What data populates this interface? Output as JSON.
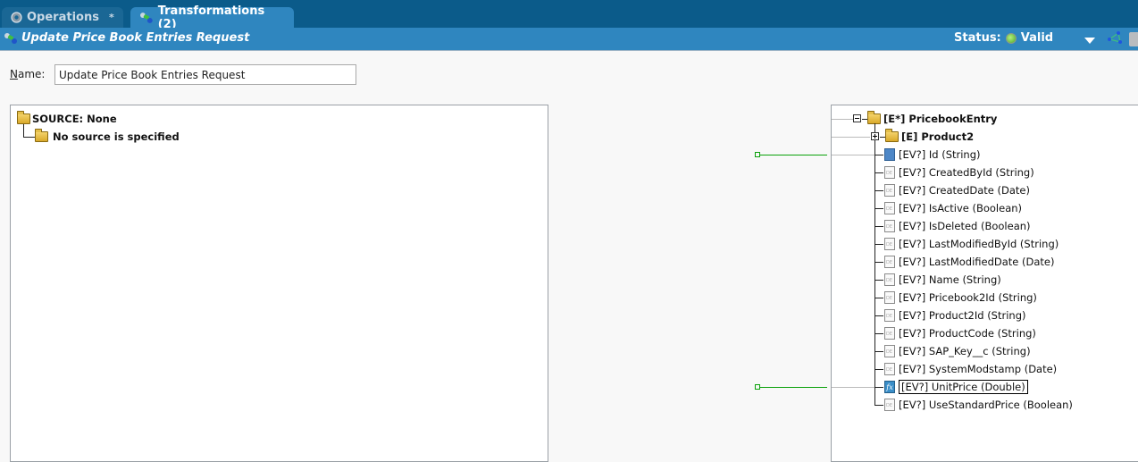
{
  "tabs": [
    {
      "label": "Operations",
      "modified_marker": "*",
      "icon": "operations-icon",
      "active": false
    },
    {
      "label": "Transformations (2)",
      "icon": "transformation-icon",
      "active": true
    }
  ],
  "header": {
    "title": "Update Price Book Entries Request",
    "status_label": "Status:",
    "status_value": "Valid",
    "status_color": "#4aa82a"
  },
  "form": {
    "name_label_accesskey": "N",
    "name_label_rest": "ame:",
    "name_value": "Update Price Book Entries Request"
  },
  "source": {
    "root": "SOURCE: None",
    "child": "No source is specified"
  },
  "target": {
    "root": "[E*] PricebookEntry",
    "child_group": "[E] Product2",
    "fields": [
      {
        "label": "[EV?] Id (String)",
        "icon": "blue-doc",
        "mapped": true
      },
      {
        "label": "[EV?] CreatedById (String)",
        "icon": "doc"
      },
      {
        "label": "[EV?] CreatedDate (Date)",
        "icon": "doc"
      },
      {
        "label": "[EV?] IsActive (Boolean)",
        "icon": "doc"
      },
      {
        "label": "[EV?] IsDeleted (Boolean)",
        "icon": "doc"
      },
      {
        "label": "[EV?] LastModifiedById (String)",
        "icon": "doc"
      },
      {
        "label": "[EV?] LastModifiedDate (Date)",
        "icon": "doc"
      },
      {
        "label": "[EV?] Name (String)",
        "icon": "doc"
      },
      {
        "label": "[EV?] Pricebook2Id (String)",
        "icon": "doc"
      },
      {
        "label": "[EV?] Product2Id (String)",
        "icon": "doc"
      },
      {
        "label": "[EV?] ProductCode (String)",
        "icon": "doc"
      },
      {
        "label": "[EV?] SAP_Key__c (String)",
        "icon": "doc"
      },
      {
        "label": "[EV?] SystemModstamp (Date)",
        "icon": "doc"
      },
      {
        "label": "[EV?] UnitPrice (Double)",
        "icon": "fx",
        "mapped": true,
        "selected": true
      },
      {
        "label": "[EV?] UseStandardPrice (Boolean)",
        "icon": "doc"
      }
    ]
  }
}
